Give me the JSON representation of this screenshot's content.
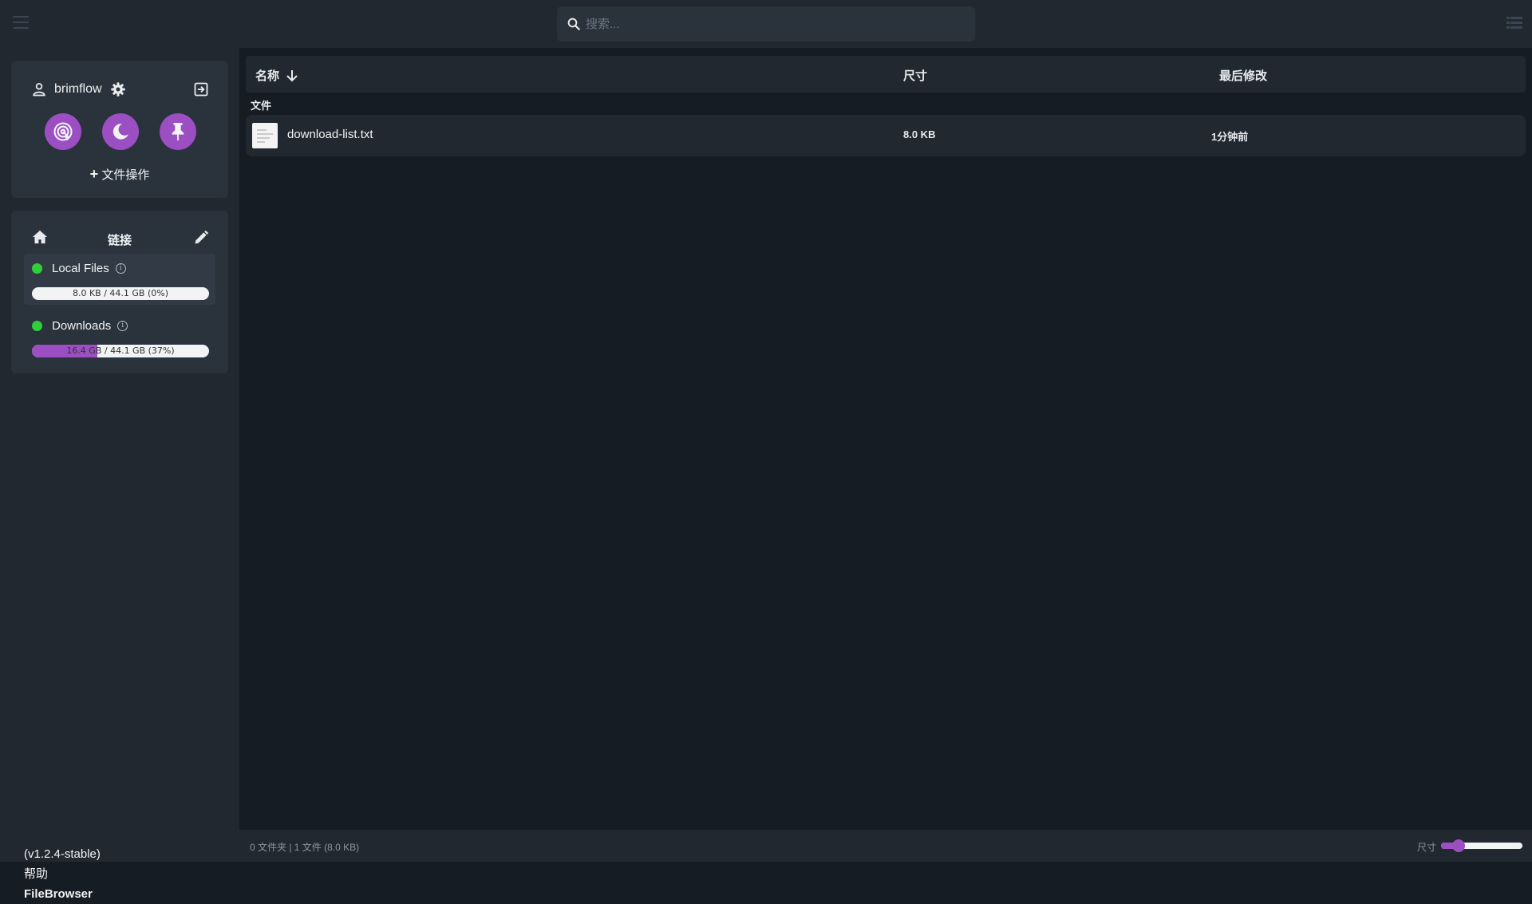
{
  "colors": {
    "accent": "#9b4fc2",
    "status_online": "#2fcf3a",
    "background": "#161c23",
    "panel": "#212830",
    "card": "#2a323b"
  },
  "header": {
    "search_placeholder": "搜索..."
  },
  "sidebar": {
    "user": {
      "username": "brimflow",
      "settings_icon": "gear-icon",
      "logout_icon": "logout-icon",
      "quick_actions": [
        "fingerprint-touch-icon",
        "moon-icon",
        "pin-icon"
      ],
      "file_ops_label": "文件操作"
    },
    "links": {
      "title": "链接",
      "sources": [
        {
          "name": "Local Files",
          "usage": "8.0 KB / 44.1 GB (0%)",
          "percent": 0,
          "status": "online"
        },
        {
          "name": "Downloads",
          "usage": "16.4 GB / 44.1 GB (37%)",
          "percent": 37,
          "status": "online"
        }
      ]
    },
    "footer": {
      "version": "(v1.2.4-stable)",
      "help": "帮助",
      "brand": "FileBrowser"
    }
  },
  "list": {
    "columns": {
      "name": "名称",
      "size": "尺寸",
      "modified": "最后修改"
    },
    "sort": {
      "column": "name",
      "direction": "descending"
    },
    "section_files": "文件",
    "files": [
      {
        "name": "download-list.txt",
        "size": "8.0 KB",
        "modified": "1分钟前"
      }
    ]
  },
  "status": {
    "counts": "0 文件夹 | 1 文件 (8.0 KB)",
    "size_label": "尺寸",
    "size_slider_fraction": 0.22
  }
}
